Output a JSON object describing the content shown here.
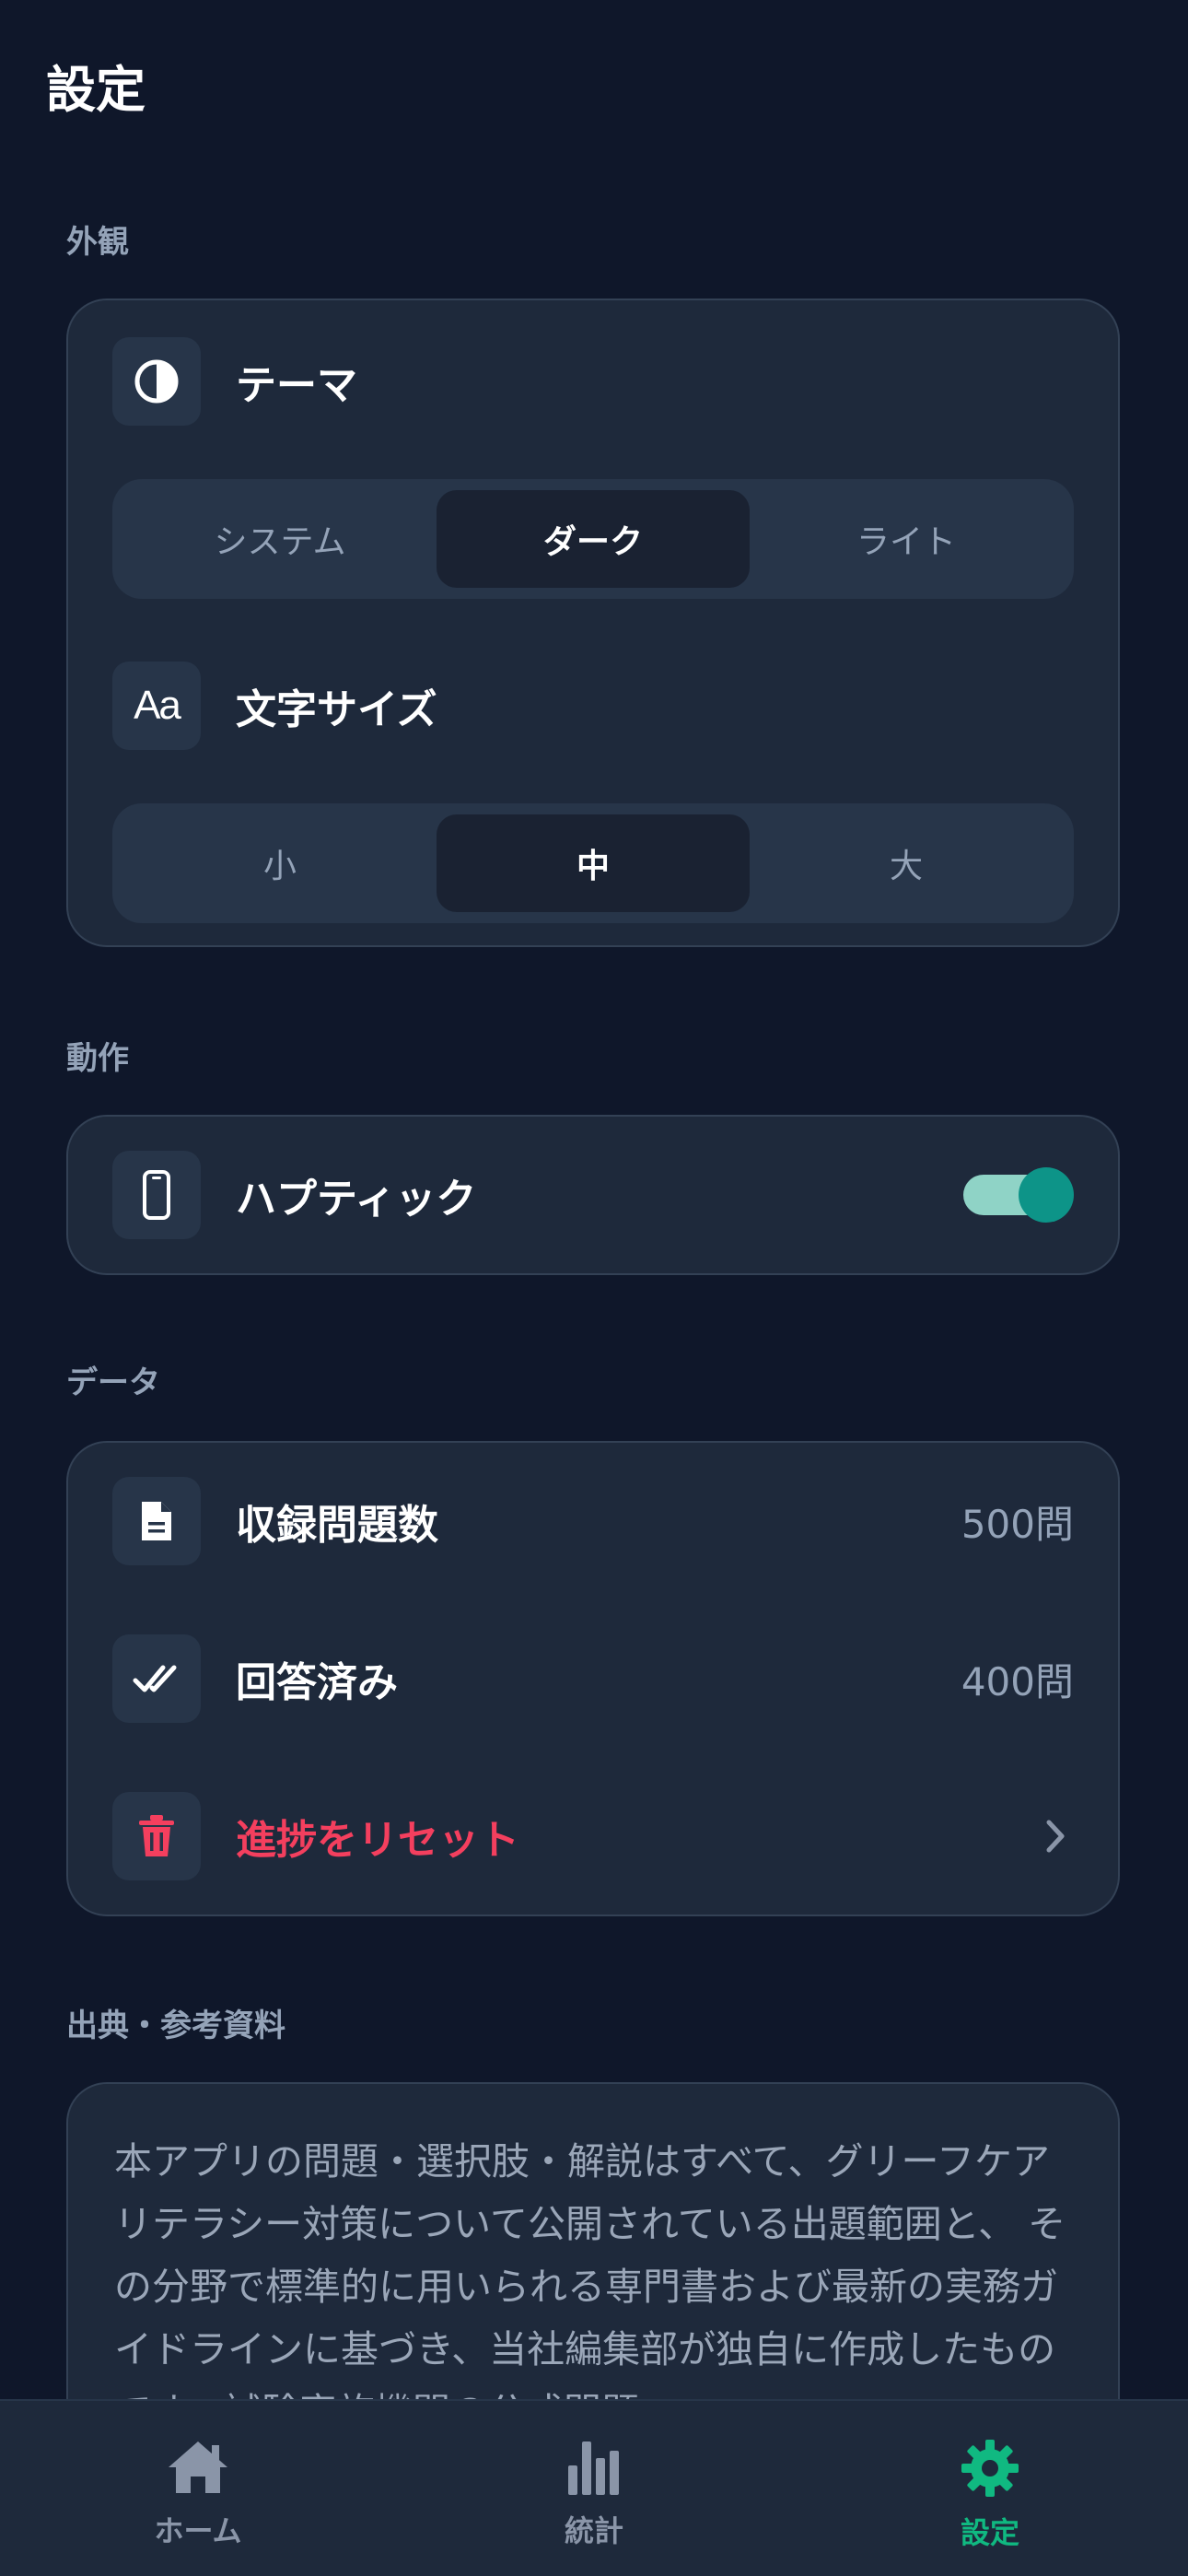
{
  "header": {
    "title": "設定"
  },
  "appearance": {
    "section_label": "外観",
    "theme": {
      "icon": "contrast-icon",
      "label": "テーマ",
      "options": [
        "システム",
        "ダーク",
        "ライト"
      ],
      "selected": "ダーク"
    },
    "font_size": {
      "icon": "text-size-icon",
      "label": "文字サイズ",
      "options": [
        "小",
        "中",
        "大"
      ],
      "selected": "中"
    }
  },
  "behavior": {
    "section_label": "動作",
    "haptic": {
      "icon": "phone-icon",
      "label": "ハプティック",
      "enabled": true
    }
  },
  "data": {
    "section_label": "データ",
    "total_questions": {
      "icon": "document-icon",
      "label": "収録問題数",
      "value": "500問"
    },
    "answered": {
      "icon": "double-check-icon",
      "label": "回答済み",
      "value": "400問"
    },
    "reset": {
      "icon": "trash-icon",
      "label": "進捗をリセット"
    }
  },
  "sources": {
    "section_label": "出典・参考資料",
    "text": "本アプリの問題・選択肢・解説はすべて、グリーフケアリテラシー対策について公開されている出題範囲と、 その分野で標準的に用いられる専門書および最新の実務ガイドラインに基づき、当社編集部が独自に作成したものです。試験実施機関の公式問題"
  },
  "tabbar": {
    "items": [
      {
        "label": "ホーム",
        "icon": "home-icon"
      },
      {
        "label": "統計",
        "icon": "chart-icon"
      },
      {
        "label": "設定",
        "icon": "gear-icon"
      }
    ],
    "active": "設定"
  },
  "colors": {
    "background": "#0f172a",
    "card": "#1e293b",
    "accent": "#0d9488",
    "tab_active": "#10b981",
    "danger": "#f43f5e"
  }
}
